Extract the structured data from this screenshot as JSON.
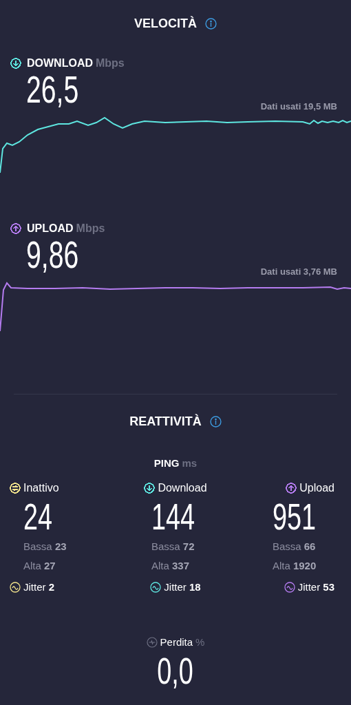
{
  "speed": {
    "title": "VELOCITÀ",
    "tests": [
      {
        "kind": "download",
        "label": "DOWNLOAD",
        "unit": "Mbps",
        "value": "26,5",
        "data_used": "Dati usati 19,5 MB",
        "color": "#5ee6e0"
      },
      {
        "kind": "upload",
        "label": "UPLOAD",
        "unit": "Mbps",
        "value": "9,86",
        "data_used": "Dati usati 3,76 MB",
        "color": "#b57cf0"
      }
    ]
  },
  "responsiveness": {
    "title": "REATTIVITÀ",
    "ping_label": "PING",
    "ping_unit": "ms",
    "columns": [
      {
        "kind": "idle",
        "label": "Inattivo",
        "value": "24",
        "low_label": "Bassa",
        "low": "23",
        "high_label": "Alta",
        "high": "27",
        "jitter_label": "Jitter",
        "jitter": "2",
        "color": "#f2e38c"
      },
      {
        "kind": "download",
        "label": "Download",
        "value": "144",
        "low_label": "Bassa",
        "low": "72",
        "high_label": "Alta",
        "high": "337",
        "jitter_label": "Jitter",
        "jitter": "18",
        "color": "#5ee6e0"
      },
      {
        "kind": "upload",
        "label": "Upload",
        "value": "951",
        "low_label": "Bassa",
        "low": "66",
        "high_label": "Alta",
        "high": "1920",
        "jitter_label": "Jitter",
        "jitter": "53",
        "color": "#b57cf0"
      }
    ],
    "loss": {
      "label": "Perdita",
      "unit": "%",
      "value": "0,0"
    }
  }
}
